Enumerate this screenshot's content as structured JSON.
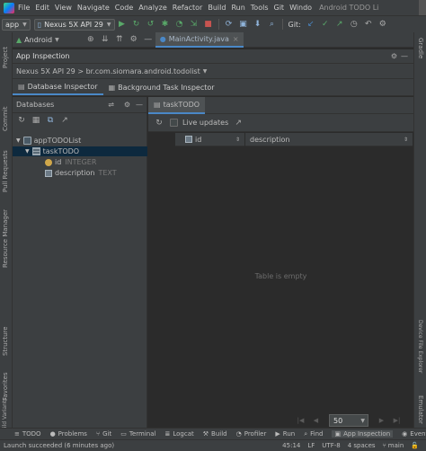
{
  "menubar": {
    "items": [
      "File",
      "Edit",
      "View",
      "Navigate",
      "Code",
      "Analyze",
      "Refactor",
      "Build",
      "Run",
      "Tools",
      "Git",
      "Windo"
    ],
    "window_title": "Android TODO Li"
  },
  "toolbar": {
    "run_config": "app",
    "device": "Nexus 5X API 29",
    "git_label": "Git:"
  },
  "project_bar": {
    "view_mode": "Android",
    "editor_tab": "MainActivity.java"
  },
  "app_inspection": {
    "title": "App Inspection",
    "process": "Nexus 5X API 29 > br.com.siomara.android.todolist",
    "tabs": [
      "Database Inspector",
      "Background Task Inspector"
    ],
    "databases_label": "Databases",
    "tree": {
      "database": "appTODOList",
      "table": "taskTODO",
      "columns": [
        {
          "name": "id",
          "type": "INTEGER"
        },
        {
          "name": "description",
          "type": "TEXT"
        }
      ]
    },
    "table_tab": "taskTODO",
    "live_updates": "Live updates",
    "grid_columns": [
      "id",
      "description"
    ],
    "empty_text": "Table is empty",
    "page_size": "50"
  },
  "left_stripe": [
    "Project",
    "Commit",
    "Pull Requests",
    "Resource Manager",
    "Structure",
    "Favorites",
    "Build Variants"
  ],
  "right_stripe": [
    "Gradle",
    "Device File Explorer",
    "Emulator"
  ],
  "bottom_tools": [
    "TODO",
    "Problems",
    "Git",
    "Terminal",
    "Logcat",
    "Build",
    "Profiler",
    "Run",
    "Find",
    "App Inspection",
    "Event Lo"
  ],
  "status": {
    "message": "Launch succeeded (6 minutes ago)",
    "position": "45:14",
    "line_sep": "LF",
    "encoding": "UTF-8",
    "indent": "4 spaces",
    "branch": "main"
  }
}
